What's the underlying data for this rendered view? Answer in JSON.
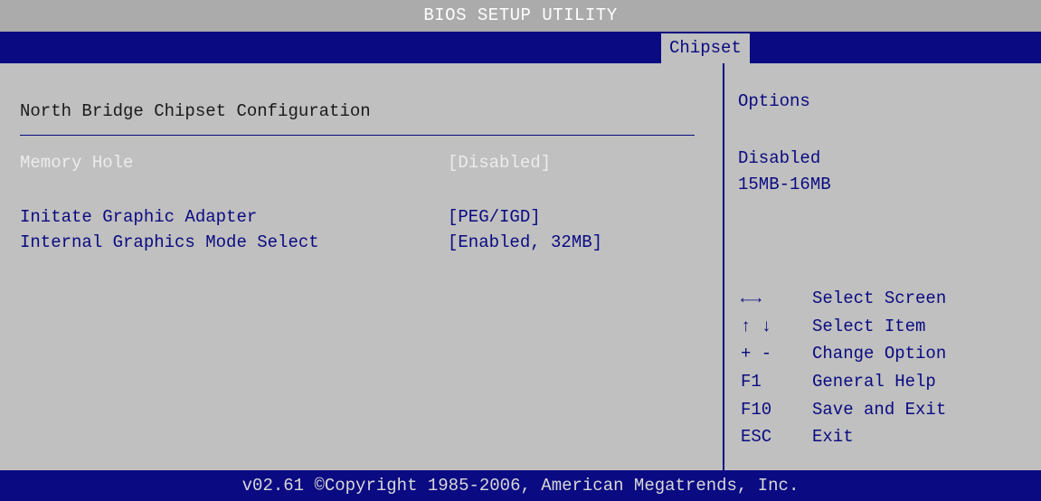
{
  "title": "BIOS SETUP UTILITY",
  "tabs": [
    {
      "label": "Chipset",
      "active": true
    }
  ],
  "main": {
    "section_title": "North Bridge Chipset Configuration",
    "settings": [
      {
        "label": "Memory Hole",
        "value": "[Disabled]",
        "state": "disabled"
      },
      {
        "label": "Initate Graphic Adapter",
        "value": "[PEG/IGD]",
        "state": "enabled"
      },
      {
        "label": "Internal Graphics Mode Select",
        "value": "[Enabled, 32MB]",
        "state": "enabled"
      }
    ]
  },
  "help": {
    "title": "Options",
    "options": [
      "Disabled",
      "15MB-16MB"
    ]
  },
  "keys": [
    {
      "key": "←→",
      "desc": "Select Screen"
    },
    {
      "key": "↑ ↓",
      "desc": "Select Item"
    },
    {
      "key": "+ -",
      "desc": "Change Option"
    },
    {
      "key": "F1",
      "desc": "General Help"
    },
    {
      "key": "F10",
      "desc": "Save and Exit"
    },
    {
      "key": "ESC",
      "desc": "Exit"
    }
  ],
  "footer": "v02.61 ©Copyright 1985-2006, American Megatrends, Inc.",
  "colors": {
    "background": "#c0c0c0",
    "title_bar": "#ababab",
    "accent_blue": "#0a0a82",
    "disabled_text": "#ececec"
  }
}
